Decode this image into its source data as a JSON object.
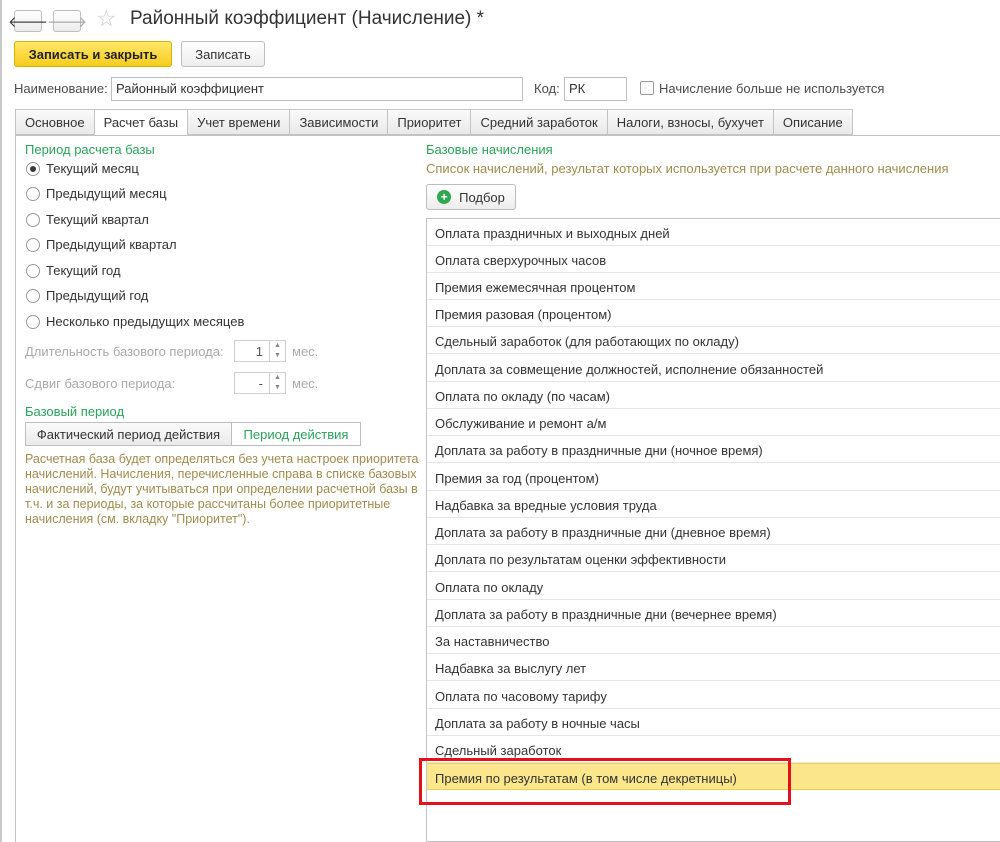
{
  "window": {
    "title": "Районный коэффициент (Начисление) *"
  },
  "toolbar": {
    "save_close": "Записать и закрыть",
    "save": "Записать"
  },
  "header": {
    "name_label": "Наименование:",
    "name_value": "Районный коэффициент",
    "code_label": "Код:",
    "code_value": "РК",
    "unused_label": "Начисление больше не используется"
  },
  "tabs": [
    "Основное",
    "Расчет базы",
    "Учет времени",
    "Зависимости",
    "Приоритет",
    "Средний заработок",
    "Налоги, взносы, бухучет",
    "Описание"
  ],
  "left": {
    "period_title": "Период расчета базы",
    "options": [
      "Текущий месяц",
      "Предыдущий месяц",
      "Текущий квартал",
      "Предыдущий квартал",
      "Текущий год",
      "Предыдущий год",
      "Несколько предыдущих месяцев"
    ],
    "duration_label": "Длительность базового периода:",
    "duration_value": "1",
    "shift_label": "Сдвиг базового периода:",
    "shift_value": "-",
    "unit": "мес.",
    "base_period_title": "Базовый период",
    "seg_actual": "Фактический период действия",
    "seg_period": "Период действия",
    "note": "Расчетная база будет определяться без учета настроек приоритета начислений. Начисления, перечисленные справа в списке базовых начислений, будут учитываться при определении расчетной базы в т.ч. и за периоды, за которые рассчитаны более приоритетные начисления (см. вкладку \"Приоритет\")."
  },
  "right": {
    "title": "Базовые начисления",
    "subtitle": "Список начислений, результат которых используется при расчете данного начисления",
    "pick_button": "Подбор",
    "items": [
      "Оплата праздничных и выходных дней",
      "Оплата сверхурочных часов",
      "Премия ежемесячная процентом",
      "Премия разовая (процентом)",
      "Сдельный заработок (для работающих по окладу)",
      "Доплата за совмещение должностей, исполнение обязанностей",
      "Оплата по окладу (по часам)",
      "Обслуживание и ремонт а/м",
      "Доплата за работу в праздничные дни (ночное время)",
      "Премия за год (процентом)",
      "Надбавка за вредные условия труда",
      "Доплата за работу в праздничные дни (дневное время)",
      "Доплата по результатам оценки эффективности",
      "Оплата по окладу",
      "Доплата за работу в праздничные дни (вечернее время)",
      "За наставничество",
      "Надбавка за выслугу лет",
      "Оплата по часовому тарифу",
      "Доплата за работу в ночные часы",
      "Сдельный заработок",
      "Премия по результатам (в том числе декретницы)"
    ]
  },
  "colors": {
    "accent_green": "#29a35a",
    "selected_row": "#fce68b",
    "highlight_red": "#e3111b",
    "primary_button": "#f6cc1d"
  },
  "icons": {
    "back": "arrow-left-icon",
    "forward": "arrow-right-icon",
    "favorite": "star-icon",
    "pick": "plus-circle-icon"
  }
}
